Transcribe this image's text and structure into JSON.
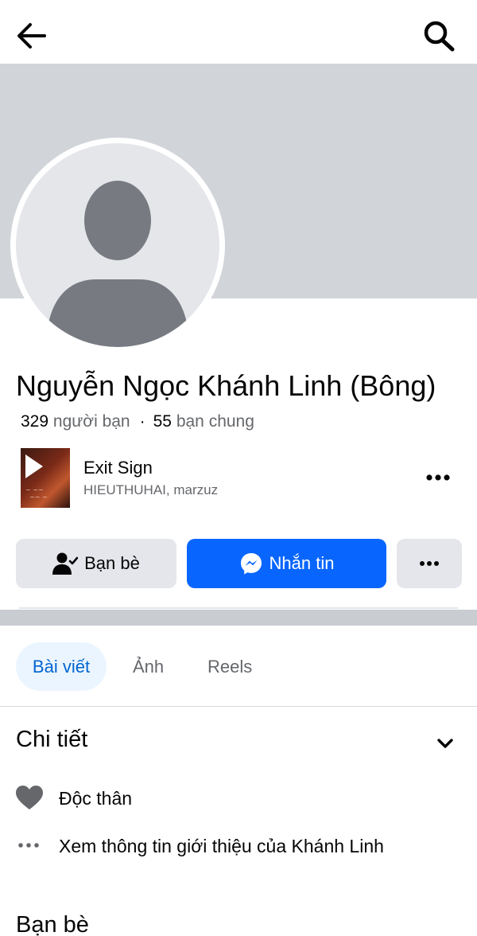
{
  "profile": {
    "name": "Nguyễn Ngọc Khánh Linh (Bông)",
    "friends_count": "329",
    "friends_label": "người bạn",
    "mutual_count": "55",
    "mutual_label": "bạn chung"
  },
  "music": {
    "title": "Exit Sign",
    "artist": "HIEUTHUHAI, marzuz"
  },
  "actions": {
    "friends_label": "Bạn bè",
    "message_label": "Nhắn tin"
  },
  "tabs": [
    {
      "label": "Bài viết",
      "active": true
    },
    {
      "label": "Ảnh",
      "active": false
    },
    {
      "label": "Reels",
      "active": false
    }
  ],
  "details": {
    "title": "Chi tiết",
    "relationship": "Độc thân",
    "see_about": "Xem thông tin giới thiệu của Khánh Linh"
  },
  "friends_section": {
    "title": "Bạn bè"
  },
  "colors": {
    "accent": "#0866ff",
    "tab_active_bg": "#ebf5ff",
    "tab_active_text": "#0064d1",
    "secondary_button": "#e4e6eb",
    "cover": "#d1d4d8"
  }
}
